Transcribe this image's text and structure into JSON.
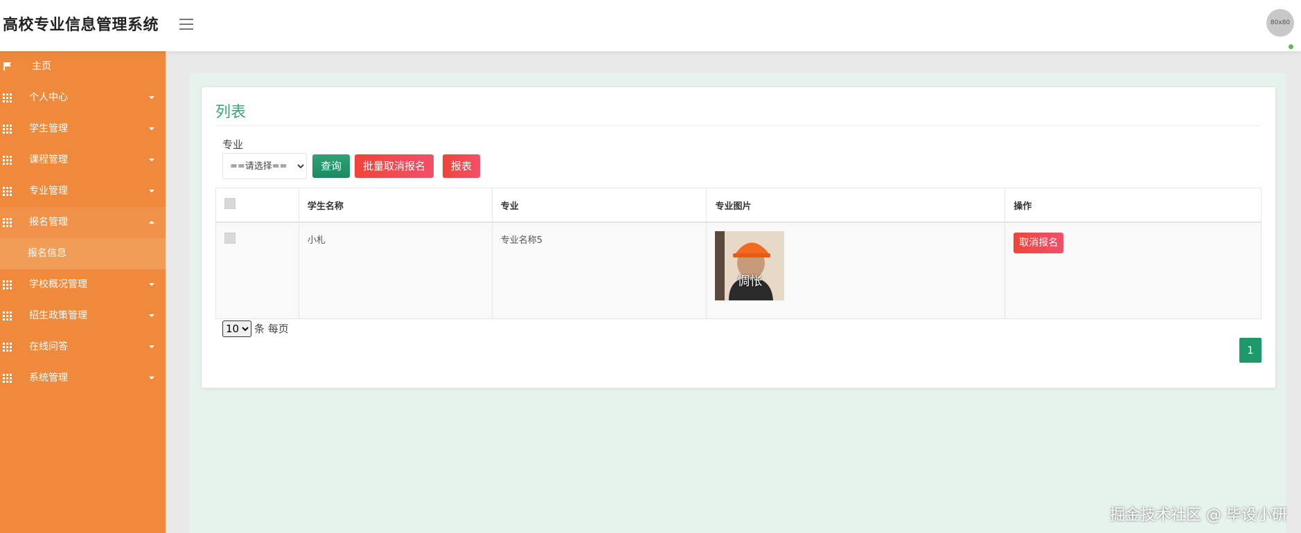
{
  "header": {
    "app_title": "高校专业信息管理系统",
    "avatar_text": "80x80"
  },
  "sidebar": {
    "items": [
      {
        "label": "主页",
        "icon": "flag-icon"
      },
      {
        "label": "个人中心",
        "icon": "grid-icon"
      },
      {
        "label": "学生管理",
        "icon": "grid-icon"
      },
      {
        "label": "课程管理",
        "icon": "grid-icon"
      },
      {
        "label": "专业管理",
        "icon": "grid-icon"
      },
      {
        "label": "报名管理",
        "icon": "grid-icon",
        "expanded": true
      },
      {
        "label": "学校概况管理",
        "icon": "grid-icon"
      },
      {
        "label": "招生政策管理",
        "icon": "grid-icon"
      },
      {
        "label": "在线问答",
        "icon": "grid-icon"
      },
      {
        "label": "系统管理",
        "icon": "grid-icon"
      }
    ],
    "sub_item": "报名信息"
  },
  "main": {
    "panel_title": "列表",
    "filter": {
      "label": "专业",
      "select_value": "==请选择=="
    },
    "buttons": {
      "query": "查询",
      "batch_cancel": "批量取消报名",
      "report": "报表"
    },
    "table": {
      "headers": [
        "学生名称",
        "专业",
        "专业图片",
        "操作"
      ],
      "rows": [
        {
          "student_name": "小札",
          "major": "专业名称5",
          "image_caption": "惆怅",
          "action": "取消报名"
        }
      ]
    },
    "page_size": {
      "value": "10",
      "suffix": "条 每页"
    },
    "pagination": {
      "current": "1"
    }
  },
  "watermark": "掘金技术社区 @ 毕设小研",
  "colors": {
    "sidebar": "#ef8a3c",
    "accent_green": "#1e9a6a",
    "danger_red": "#f0443a",
    "title_green": "#3aa675"
  }
}
